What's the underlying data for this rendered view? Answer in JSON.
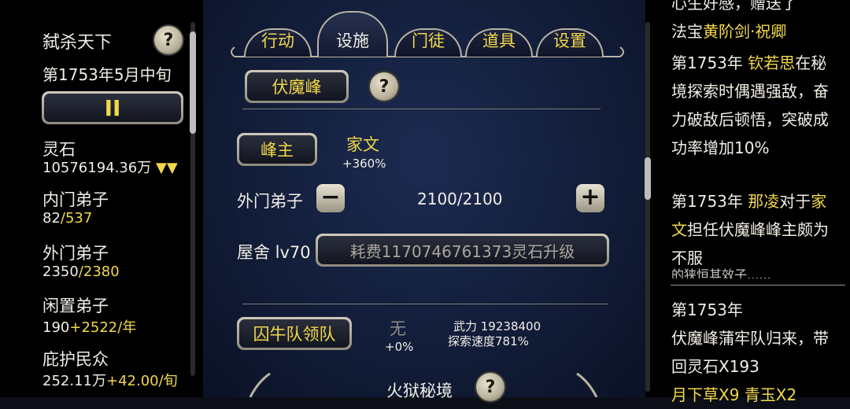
{
  "left": {
    "title": "弑杀天下",
    "date": "第1753年5月中旬",
    "pause_symbol": "II",
    "stats": [
      {
        "label": "灵石",
        "value": "10576194.36万",
        "extra": "▼▼"
      },
      {
        "label": "内门弟子",
        "value": "82",
        "extra": "/537"
      },
      {
        "label": "外门弟子",
        "value": "2350",
        "extra": "/2380"
      },
      {
        "label": "闲置弟子",
        "value": "190",
        "extra": "+2522/年"
      },
      {
        "label": "庇护民众",
        "value": "252.11万",
        "extra": "+42.00/旬"
      }
    ]
  },
  "tabs": [
    "行动",
    "设施",
    "门徒",
    "道具",
    "设置"
  ],
  "active_tab": "设施",
  "facility": {
    "name": "伏魔峰",
    "leader_btn": "峰主",
    "leader_name": "家文",
    "leader_bonus": "+360%",
    "outer_label": "外门弟子",
    "outer_value": "2100/2100",
    "house_label": "屋舍 lv70",
    "upgrade_btn": "耗费1170746761373灵石升级",
    "team_btn": "囚牛队领队",
    "team_leader": "无",
    "team_bonus": "+0%",
    "team_power": "武力  19238400",
    "team_speed": "探索速度781%",
    "next_section": "火狱秘境"
  },
  "log": {
    "cut_top": "心生好感，赠送了",
    "e0_a": "法宝",
    "e0_b": "黄阶剑·祝卿",
    "e1_year": "第1753年",
    "e1_name": "钦若思",
    "e1_text_a": "在",
    "e1_text_b": "秘境探索时偶遇强敌，奋力破敌后顿悟，突破成功率增加10%",
    "e2_year": "第1753年",
    "e2_name": "那凌",
    "e2_text_a": "对于",
    "e2_name2": "家文",
    "e2_text_b": "担任伏魔峰峰主颇为不服",
    "cut_mid": "的狭恒其效子......",
    "e3_year": "第1753年",
    "e3_text": "伏魔峰蒲牢队归来，带回灵石X193",
    "e3_item1": "月下草X9",
    "e3_item2": "青玉X2"
  },
  "colors": {
    "accent": "#f2d84a",
    "text": "#f1eee4",
    "panel_mid": "#14203e"
  }
}
